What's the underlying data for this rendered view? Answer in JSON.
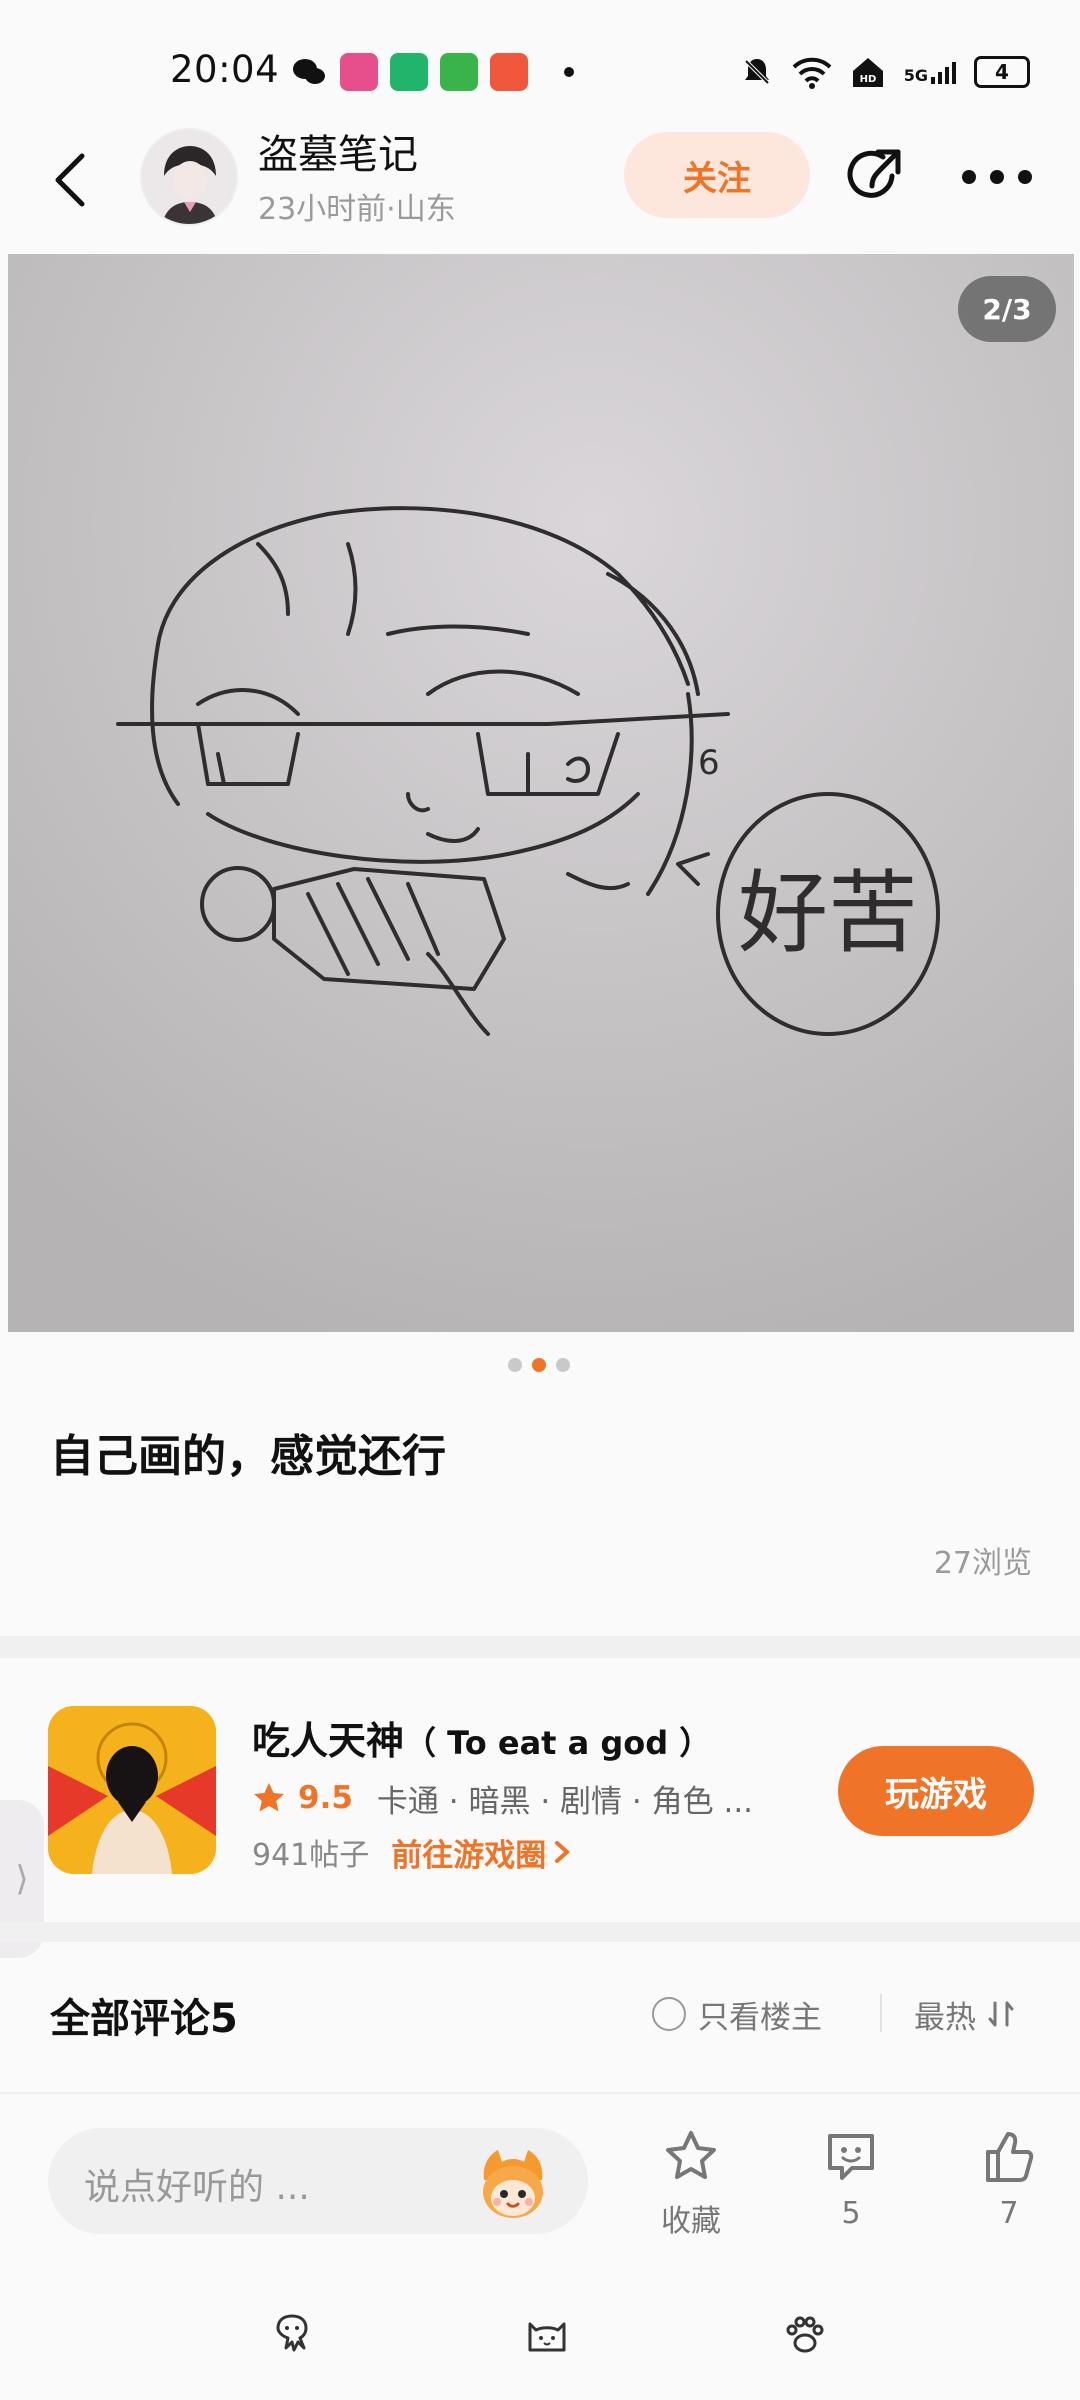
{
  "status_bar": {
    "time": "20:04",
    "network": "5G",
    "battery": "4",
    "app_icon_colors": [
      "#e64f8b",
      "#20b56a",
      "#39b44a",
      "#f1573b"
    ]
  },
  "header": {
    "author_name": "盗墓笔记",
    "meta": "23小时前·山东",
    "follow_label": "关注",
    "icons": [
      "back-arrow-icon",
      "share-icon",
      "more-icon"
    ]
  },
  "image": {
    "pager": "2/3",
    "speech_text": "好苦",
    "dots_total": 3,
    "dots_active": 2
  },
  "post": {
    "title": "自己画的，感觉还行",
    "views": "27浏览"
  },
  "game": {
    "name": "吃人天神",
    "name_en": "（ To eat a god ）",
    "rating": "9.5",
    "tags": "卡通 · 暗黑 · 剧情 · 角色 ...",
    "posts": "941帖子",
    "link_label": "前往游戏圈",
    "play_label": "玩游戏",
    "side_tab": "⟩"
  },
  "comments": {
    "title": "全部评论5",
    "only_op": "只看楼主",
    "sort": "最热"
  },
  "bottom_bar": {
    "input_placeholder": "说点好听的 ...",
    "favorite_label": "收藏",
    "comment_count": "5",
    "like_count": "7"
  },
  "colors": {
    "accent": "#f07428",
    "follow_bg": "#fde7dc",
    "background": "#fbfafb"
  }
}
